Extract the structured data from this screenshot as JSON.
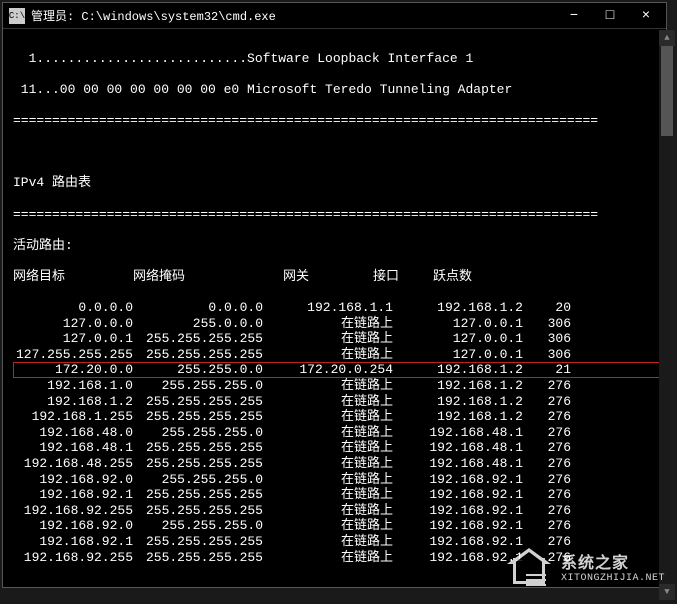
{
  "window": {
    "icon_label": "C:\\",
    "title": "管理员: C:\\windows\\system32\\cmd.exe",
    "min": "−",
    "max": "□",
    "close": "×"
  },
  "intro": {
    "line1": "  1...........................Software Loopback Interface 1",
    "line2": " 11...00 00 00 00 00 00 00 e0 Microsoft Teredo Tunneling Adapter",
    "sep": "==========================================================================="
  },
  "headers": {
    "section": "IPv4 路由表",
    "active": "活动路由:",
    "dest": "网络目标",
    "mask": "网络掩码",
    "gateway": "网关",
    "iface": "接口",
    "metric": "跃点数"
  },
  "routes": [
    {
      "dest": "0.0.0.0",
      "mask": "0.0.0.0",
      "gw": "192.168.1.1",
      "if": "192.168.1.2",
      "metric": "20",
      "hl": false
    },
    {
      "dest": "127.0.0.0",
      "mask": "255.0.0.0",
      "gw": "在链路上",
      "if": "127.0.0.1",
      "metric": "306",
      "hl": false
    },
    {
      "dest": "127.0.0.1",
      "mask": "255.255.255.255",
      "gw": "在链路上",
      "if": "127.0.0.1",
      "metric": "306",
      "hl": false
    },
    {
      "dest": "127.255.255.255",
      "mask": "255.255.255.255",
      "gw": "在链路上",
      "if": "127.0.0.1",
      "metric": "306",
      "hl": false
    },
    {
      "dest": "172.20.0.0",
      "mask": "255.255.0.0",
      "gw": "172.20.0.254",
      "if": "192.168.1.2",
      "metric": "21",
      "hl": true
    },
    {
      "dest": "192.168.1.0",
      "mask": "255.255.255.0",
      "gw": "在链路上",
      "if": "192.168.1.2",
      "metric": "276",
      "hl": false
    },
    {
      "dest": "192.168.1.2",
      "mask": "255.255.255.255",
      "gw": "在链路上",
      "if": "192.168.1.2",
      "metric": "276",
      "hl": false
    },
    {
      "dest": "192.168.1.255",
      "mask": "255.255.255.255",
      "gw": "在链路上",
      "if": "192.168.1.2",
      "metric": "276",
      "hl": false
    },
    {
      "dest": "192.168.48.0",
      "mask": "255.255.255.0",
      "gw": "在链路上",
      "if": "192.168.48.1",
      "metric": "276",
      "hl": false
    },
    {
      "dest": "192.168.48.1",
      "mask": "255.255.255.255",
      "gw": "在链路上",
      "if": "192.168.48.1",
      "metric": "276",
      "hl": false
    },
    {
      "dest": "192.168.48.255",
      "mask": "255.255.255.255",
      "gw": "在链路上",
      "if": "192.168.48.1",
      "metric": "276",
      "hl": false
    },
    {
      "dest": "192.168.92.0",
      "mask": "255.255.255.0",
      "gw": "在链路上",
      "if": "192.168.92.1",
      "metric": "276",
      "hl": false
    },
    {
      "dest": "192.168.92.1",
      "mask": "255.255.255.255",
      "gw": "在链路上",
      "if": "192.168.92.1",
      "metric": "276",
      "hl": false
    },
    {
      "dest": "192.168.92.255",
      "mask": "255.255.255.255",
      "gw": "在链路上",
      "if": "192.168.92.1",
      "metric": "276",
      "hl": false
    },
    {
      "dest": "192.168.92.0",
      "mask": "255.255.255.0",
      "gw": "在链路上",
      "if": "192.168.92.1",
      "metric": "276",
      "hl": false
    },
    {
      "dest": "192.168.92.1",
      "mask": "255.255.255.255",
      "gw": "在链路上",
      "if": "192.168.92.1",
      "metric": "276",
      "hl": false
    },
    {
      "dest": "192.168.92.255",
      "mask": "255.255.255.255",
      "gw": "在链路上",
      "if": "192.168.92.1",
      "metric": "276",
      "hl": false
    }
  ],
  "watermark": {
    "cn": "系统之家",
    "en": "XITONGZHIJIA.NET"
  }
}
